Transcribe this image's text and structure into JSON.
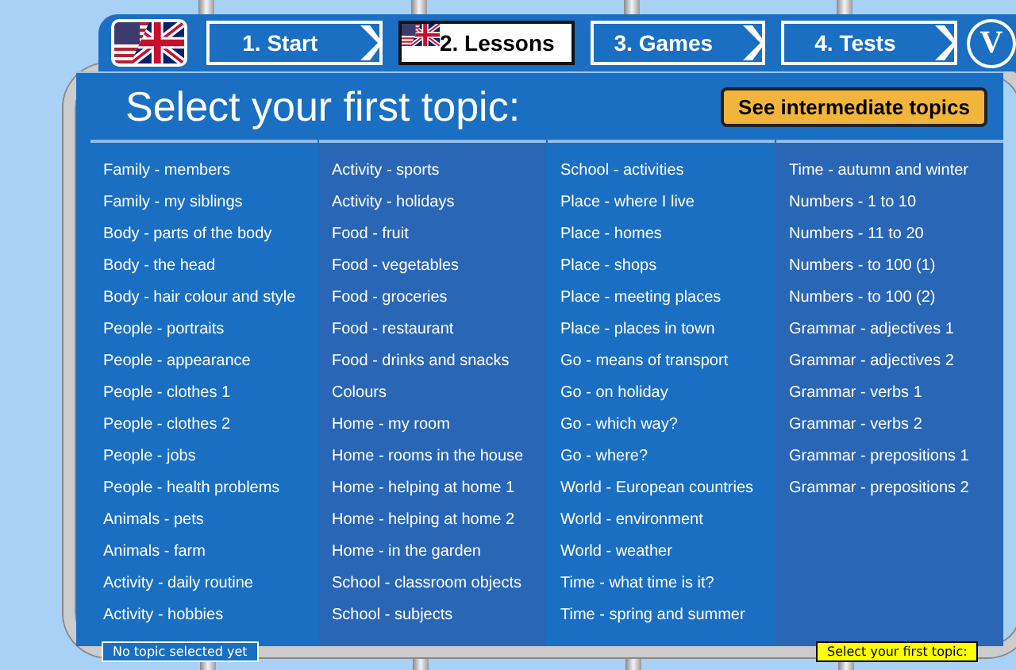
{
  "nav": {
    "tabs": [
      {
        "label": "1. Start",
        "selected": false
      },
      {
        "label": "2. Lessons",
        "selected": true
      },
      {
        "label": "3. Games",
        "selected": false
      },
      {
        "label": "4. Tests",
        "selected": false
      }
    ],
    "round_button": "V"
  },
  "heading": "Select your first topic:",
  "intermediate_button": "See intermediate topics",
  "topic_columns": [
    {
      "items": [
        "Family - members",
        "Family - my siblings",
        "Body - parts of the body",
        "Body - the head",
        "Body - hair colour and style",
        "People - portraits",
        "People - appearance",
        "People - clothes 1",
        "People - clothes 2",
        "People - jobs",
        "People - health problems",
        "Animals - pets",
        "Animals - farm",
        "Activity - daily routine",
        "Activity - hobbies"
      ]
    },
    {
      "items": [
        "Activity - sports",
        "Activity - holidays",
        "Food - fruit",
        "Food - vegetables",
        "Food - groceries",
        "Food - restaurant",
        "Food - drinks and snacks",
        "Colours",
        "Home - my room",
        "Home - rooms in the house",
        "Home - helping at home 1",
        "Home - helping at home 2",
        "Home - in the garden",
        "School - classroom objects",
        "School - subjects"
      ]
    },
    {
      "items": [
        "School - activities",
        "Place - where I live",
        "Place - homes",
        "Place - shops",
        "Place - meeting places",
        "Place - places in town",
        "Go - means of transport",
        "Go - on holiday",
        "Go - which way?",
        "Go - where?",
        "World - European countries",
        "World - environment",
        "World - weather",
        "Time - what time is it?",
        "Time - spring and summer"
      ]
    },
    {
      "items": [
        "Time - autumn and winter",
        "Numbers - 1 to 10",
        "Numbers - 11 to 20",
        "Numbers - to 100 (1)",
        "Numbers - to 100 (2)",
        "Grammar - adjectives 1",
        "Grammar - adjectives 2",
        "Grammar - verbs 1",
        "Grammar - verbs 2",
        "Grammar - prepositions 1",
        "Grammar - prepositions 2"
      ]
    }
  ],
  "status_left": "No topic selected yet",
  "status_right": "Select your first topic:"
}
